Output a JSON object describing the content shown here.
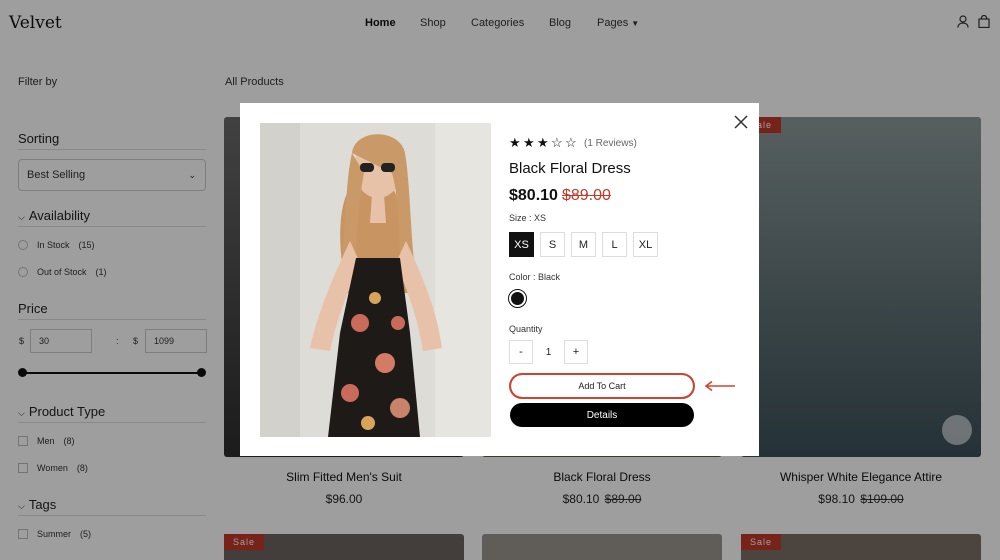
{
  "header": {
    "logo": "Velvet",
    "nav": [
      "Home",
      "Shop",
      "Categories",
      "Blog",
      "Pages"
    ],
    "icons": [
      "user-icon",
      "bag-icon"
    ]
  },
  "sidebar": {
    "filter_by": "Filter by",
    "sorting": {
      "title": "Sorting",
      "selected": "Best Selling"
    },
    "availability": {
      "title": "Availability",
      "options": [
        {
          "label": "In Stock",
          "count": "(15)"
        },
        {
          "label": "Out of Stock",
          "count": "(1)"
        }
      ]
    },
    "price": {
      "title": "Price",
      "currency": "$",
      "min": "30",
      "separator": ":",
      "max": "1099"
    },
    "product_type": {
      "title": "Product Type",
      "options": [
        {
          "label": "Men",
          "count": "(8)"
        },
        {
          "label": "Women",
          "count": "(8)"
        }
      ]
    },
    "tags": {
      "title": "Tags",
      "options": [
        {
          "label": "Summer",
          "count": "(5)"
        }
      ]
    }
  },
  "main": {
    "heading": "All Products",
    "sale_label": "Sale",
    "products": [
      {
        "name": "Slim Fitted Men's Suit",
        "price": "$96.00",
        "old_price": ""
      },
      {
        "name": "Black Floral Dress",
        "price": "$80.10",
        "old_price": "$89.00"
      },
      {
        "name": "Whisper White Elegance Attire",
        "price": "$98.10",
        "old_price": "$109.00"
      }
    ]
  },
  "modal": {
    "rating": 3,
    "rating_max": 5,
    "reviews": "(1 Reviews)",
    "title": "Black Floral Dress",
    "price": "$80.10",
    "old_price": "$89.00",
    "size_label": "Size : XS",
    "sizes": [
      "XS",
      "S",
      "M",
      "L",
      "XL"
    ],
    "selected_size": "XS",
    "color_label": "Color : Black",
    "color": "#111111",
    "quantity_label": "Quantity",
    "quantity": "1",
    "minus": "-",
    "plus": "+",
    "add_to_cart": "Add To Cart",
    "details": "Details",
    "highlight_color": "#d0432f"
  }
}
